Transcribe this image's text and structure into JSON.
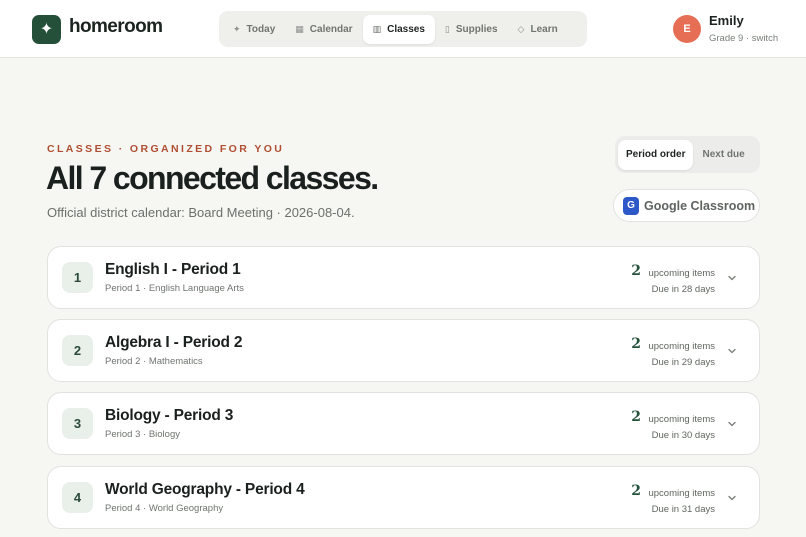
{
  "app": {
    "name": "homeroom",
    "logo_glyph": "✦"
  },
  "nav": {
    "items": [
      {
        "label": "Today",
        "icon": "sparkle-icon",
        "glyph": "✦",
        "active": false
      },
      {
        "label": "Calendar",
        "icon": "calendar-icon",
        "glyph": "▦",
        "active": false
      },
      {
        "label": "Classes",
        "icon": "classes-icon",
        "glyph": "▥",
        "active": true
      },
      {
        "label": "Supplies",
        "icon": "supplies-icon",
        "glyph": "▯",
        "active": false
      },
      {
        "label": "Learn",
        "icon": "learn-icon",
        "glyph": "◇",
        "active": false
      }
    ]
  },
  "user": {
    "initial": "E",
    "name": "Emily",
    "grade": "Grade 9",
    "separator": "·",
    "switch_label": "switch"
  },
  "page": {
    "eyebrow": "CLASSES · ORGANIZED FOR YOU",
    "title": "All 7 connected classes.",
    "subtitle": "Official district calendar: Board Meeting · 2026-08-04."
  },
  "sort": {
    "options": [
      "Period order",
      "Next due"
    ],
    "selected": "Period order"
  },
  "google_classroom": {
    "icon_letter": "G",
    "label": "Google Classroom"
  },
  "classes": [
    {
      "period_number": "1",
      "name": "English I - Period 1",
      "meta": "Period 1 · English Language Arts",
      "upcoming_count": "2",
      "upcoming_label": "upcoming items",
      "due": "Due in 28 days"
    },
    {
      "period_number": "2",
      "name": "Algebra I - Period 2",
      "meta": "Period 2 · Mathematics",
      "upcoming_count": "2",
      "upcoming_label": "upcoming items",
      "due": "Due in 29 days"
    },
    {
      "period_number": "3",
      "name": "Biology - Period 3",
      "meta": "Period 3 · Biology",
      "upcoming_count": "2",
      "upcoming_label": "upcoming items",
      "due": "Due in 30 days"
    },
    {
      "period_number": "4",
      "name": "World Geography - Period 4",
      "meta": "Period 4 · World Geography",
      "upcoming_count": "2",
      "upcoming_label": "upcoming items",
      "due": "Due in 31 days"
    }
  ],
  "colors": {
    "brand": "#24503a",
    "accent": "#b04f32",
    "avatar": "#e56e55",
    "google_blue": "#2d58c8"
  }
}
